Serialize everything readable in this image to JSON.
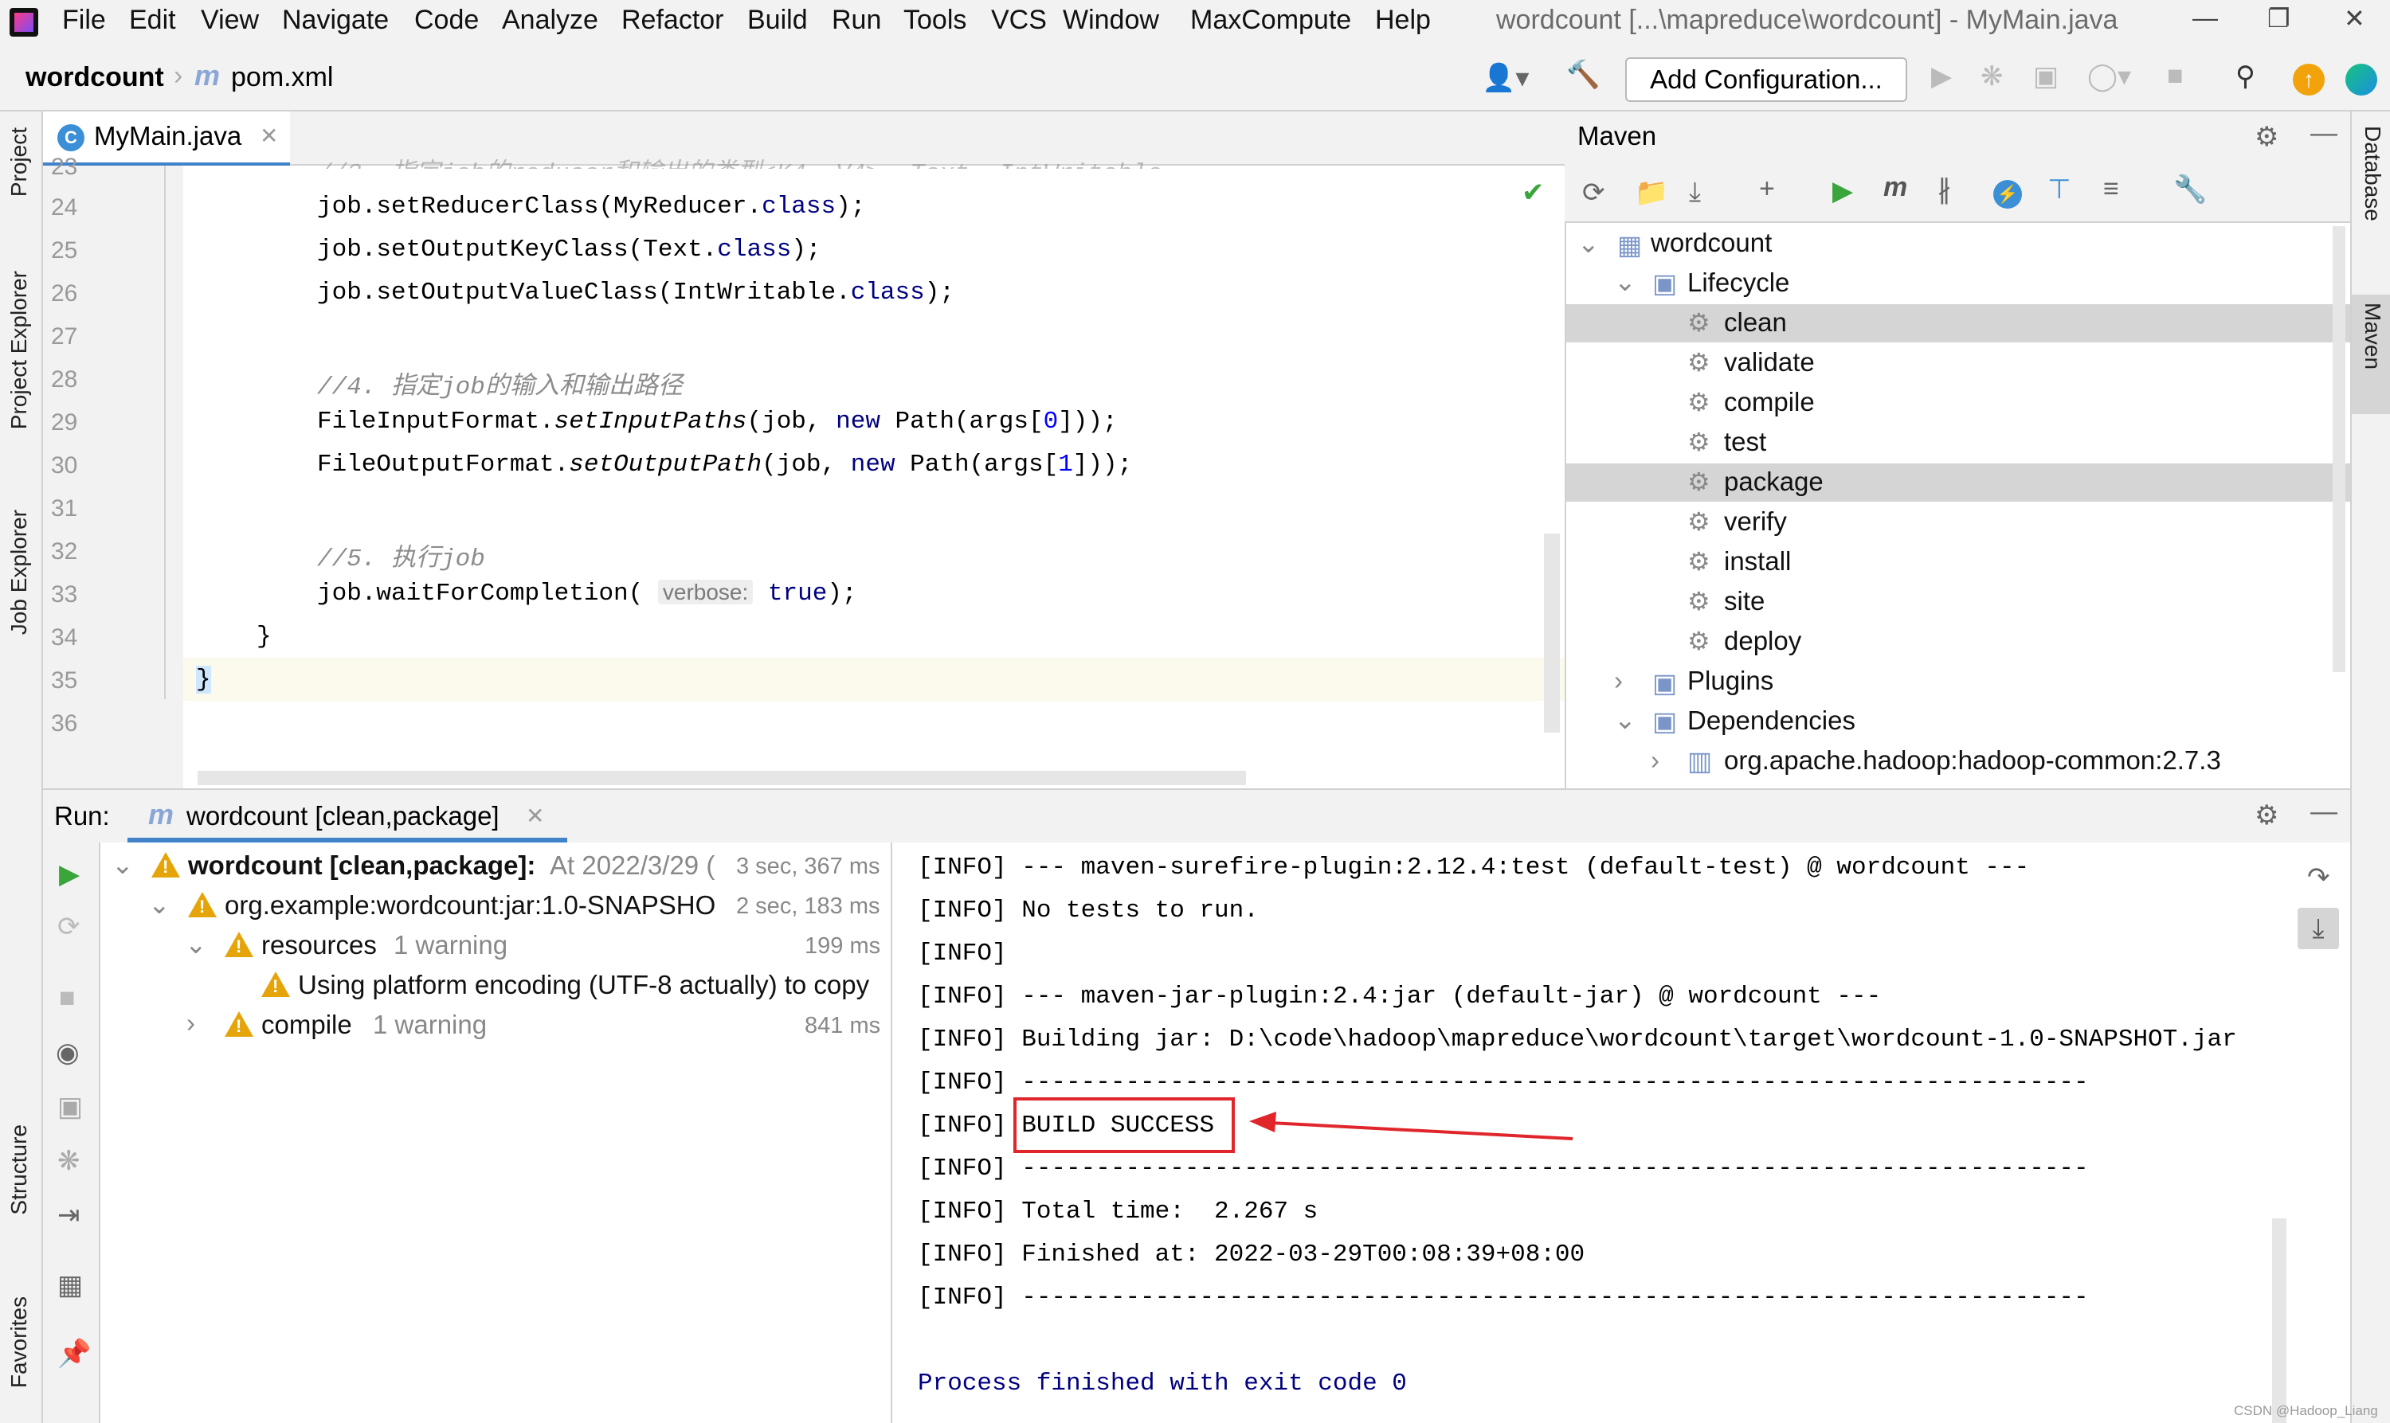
{
  "menu": {
    "items": [
      "File",
      "Edit",
      "View",
      "Navigate",
      "Code",
      "Analyze",
      "Refactor",
      "Build",
      "Run",
      "Tools",
      "VCS",
      "Window",
      "MaxCompute",
      "Help"
    ],
    "window_title": "wordcount [...\\mapreduce\\wordcount] - MyMain.java"
  },
  "navbar": {
    "project": "wordcount",
    "file": "pom.xml",
    "add_config_label": "Add Configuration..."
  },
  "left_tabs": [
    "Project",
    "Project Explorer",
    "Job Explorer",
    "Structure",
    "Favorites"
  ],
  "right_tabs": [
    "Database",
    "Maven"
  ],
  "editor": {
    "tab_label": "MyMain.java",
    "line_numbers": [
      "23",
      "24",
      "25",
      "26",
      "27",
      "28",
      "29",
      "30",
      "31",
      "32",
      "33",
      "34",
      "35",
      "36"
    ],
    "param_hint": "verbose:"
  },
  "maven": {
    "title": "Maven",
    "root": "wordcount",
    "lifecycle_label": "Lifecycle",
    "lifecycle": [
      "clean",
      "validate",
      "compile",
      "test",
      "package",
      "verify",
      "install",
      "site",
      "deploy"
    ],
    "plugins_label": "Plugins",
    "dependencies_label": "Dependencies",
    "dependency": "org.apache.hadoop:hadoop-common:2.7.3"
  },
  "run": {
    "label": "Run:",
    "tab_label": "wordcount [clean,package]",
    "tree": {
      "root_label": "wordcount [clean,package]:",
      "root_time_prefix": "At 2022/3/29 (",
      "root_duration": "3 sec, 367 ms",
      "module": "org.example:wordcount:jar:1.0-SNAPSHO",
      "module_duration": "2 sec, 183 ms",
      "resources": "resources",
      "resources_warn": "1 warning",
      "resources_duration": "199 ms",
      "message": "Using platform encoding (UTF-8 actually) to copy",
      "compile": "compile",
      "compile_warn": "1 warning",
      "compile_duration": "841 ms"
    },
    "console": [
      "[INFO] --- maven-surefire-plugin:2.12.4:test (default-test) @ wordcount ---",
      "[INFO] No tests to run.",
      "[INFO]",
      "[INFO] --- maven-jar-plugin:2.4:jar (default-jar) @ wordcount ---",
      "[INFO] Building jar: D:\\code\\hadoop\\mapreduce\\wordcount\\target\\wordcount-1.0-SNAPSHOT.jar",
      "[INFO] ------------------------------------------------------------------------",
      "[INFO] BUILD SUCCESS",
      "[INFO] ------------------------------------------------------------------------",
      "[INFO] Total time:  2.267 s",
      "[INFO] Finished at: 2022-03-29T00:08:39+08:00",
      "[INFO] ------------------------------------------------------------------------"
    ],
    "exit_message": "Process finished with exit code 0"
  },
  "watermark": "CSDN @Hadoop_Liang",
  "colors": {
    "accent": "#4083c9",
    "keyword": "#000080",
    "number": "#0000ff",
    "comment": "#8c8c8c",
    "warning": "#e5a50a",
    "annotation_red": "#e0262b",
    "run_green": "#3aa53a"
  }
}
